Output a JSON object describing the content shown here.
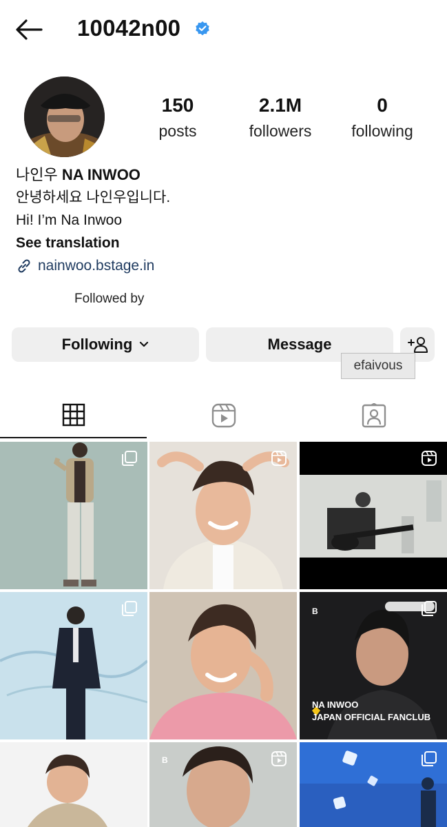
{
  "header": {
    "username": "10042n00"
  },
  "stats": {
    "posts": {
      "value": "150",
      "label": "posts"
    },
    "followers": {
      "value": "2.1M",
      "label": "followers"
    },
    "following": {
      "value": "0",
      "label": "following"
    }
  },
  "bio": {
    "name_ko": "나인우",
    "name_en": "NA INWOO",
    "line1": "안녕하세요 나인우입니다.",
    "line2": "Hi! I’m Na Inwoo",
    "see_translation": "See translation",
    "link": "nainwoo.bstage.in"
  },
  "followed_by": "Followed by",
  "buttons": {
    "following": "Following",
    "message": "Message"
  },
  "tooltip": "efaivous",
  "grid": {
    "fanclub_line1": "NA INWOO",
    "fanclub_line2": "JAPAN OFFICIAL FANCLUB"
  },
  "colors": {
    "verified": "#3897f0",
    "link": "#1e3a5f"
  }
}
